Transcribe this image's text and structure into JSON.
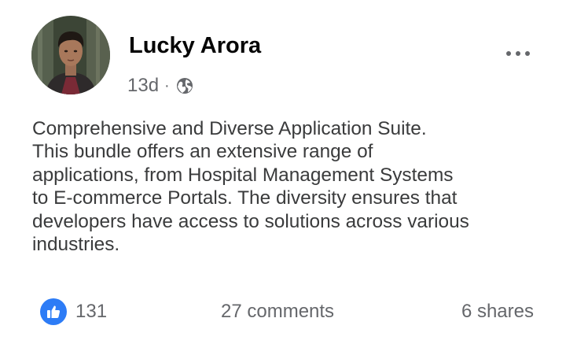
{
  "post": {
    "author": {
      "name": "Lucky Arora",
      "avatar": "profile-photo"
    },
    "meta": {
      "time": "13d",
      "separator": "·",
      "privacy_icon": "globe-icon"
    },
    "menu_icon": "more-options-icon",
    "text_lines": [
      "Comprehensive and Diverse Application Suite.",
      "This bundle offers an extensive range of",
      "applications, from Hospital Management Systems",
      "to E-commerce Portals. The diversity ensures that",
      "developers have access to solutions across various",
      "industries."
    ],
    "footer": {
      "reaction_icon": "like-icon",
      "reaction_count": "131",
      "comments": "27 comments",
      "shares": "6 shares"
    }
  },
  "colors": {
    "like_blue": "#2d7cf6",
    "secondary_text": "#65676b",
    "body_text": "#3a3b3c",
    "name_text": "#050505"
  }
}
